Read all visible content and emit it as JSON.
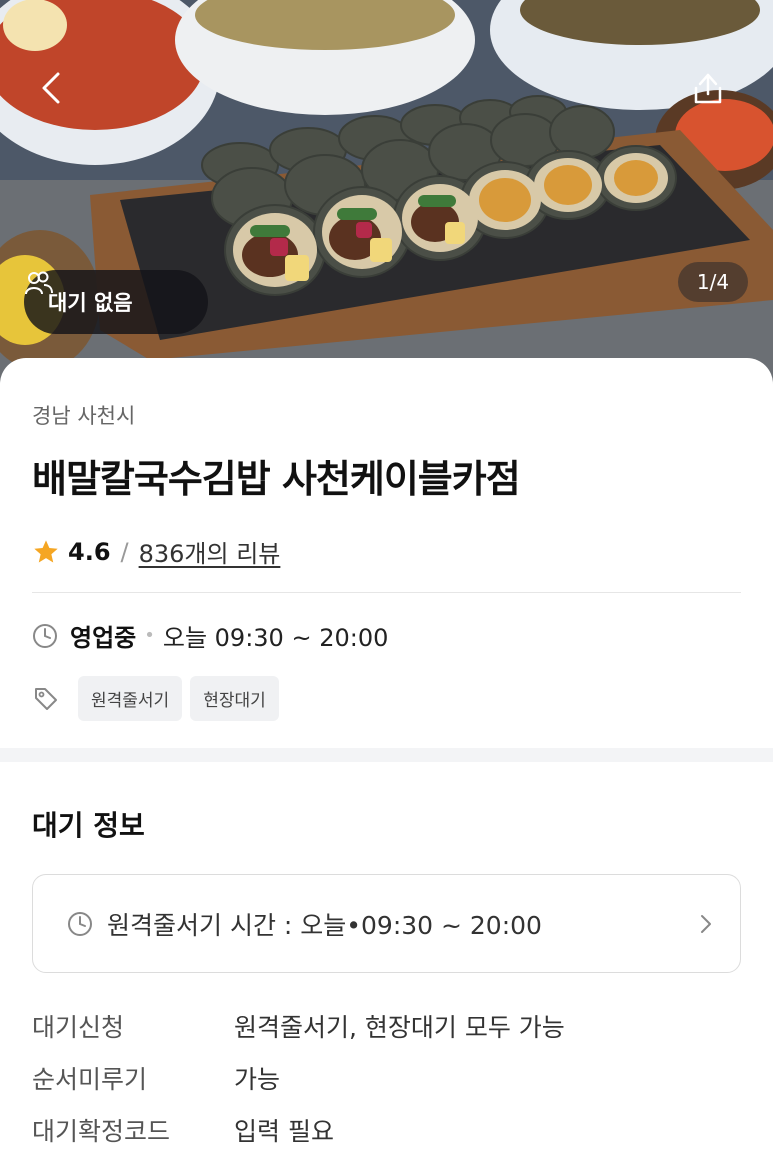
{
  "header": {
    "photo_counter": "1/4",
    "wait_badge": "대기 없음"
  },
  "store": {
    "region": "경남 사천시",
    "name": "배말칼국수김밥 사천케이블카점",
    "rating": "4.6",
    "rating_separator": "/",
    "review_count": "836개의 리뷰",
    "status": "영업중",
    "hours": "오늘 09:30 ~ 20:00",
    "tags": [
      "원격줄서기",
      "현장대기"
    ]
  },
  "wait_info": {
    "title": "대기 정보",
    "remote_hours": "원격줄서기 시간 : 오늘•09:30 ~ 20:00",
    "details": [
      {
        "key": "대기신청",
        "value": "원격줄서기, 현장대기 모두 가능"
      },
      {
        "key": "순서미루기",
        "value": "가능"
      },
      {
        "key": "대기확정코드",
        "value": "입력 필요"
      }
    ]
  },
  "colors": {
    "star": "#f5a623",
    "tag_bg": "#f0f1f3",
    "divider": "#e6e6e6"
  },
  "icons": [
    "chevron-left-icon",
    "share-icon",
    "people-icon",
    "star-icon",
    "clock-icon",
    "tag-icon",
    "chevron-right-icon"
  ]
}
